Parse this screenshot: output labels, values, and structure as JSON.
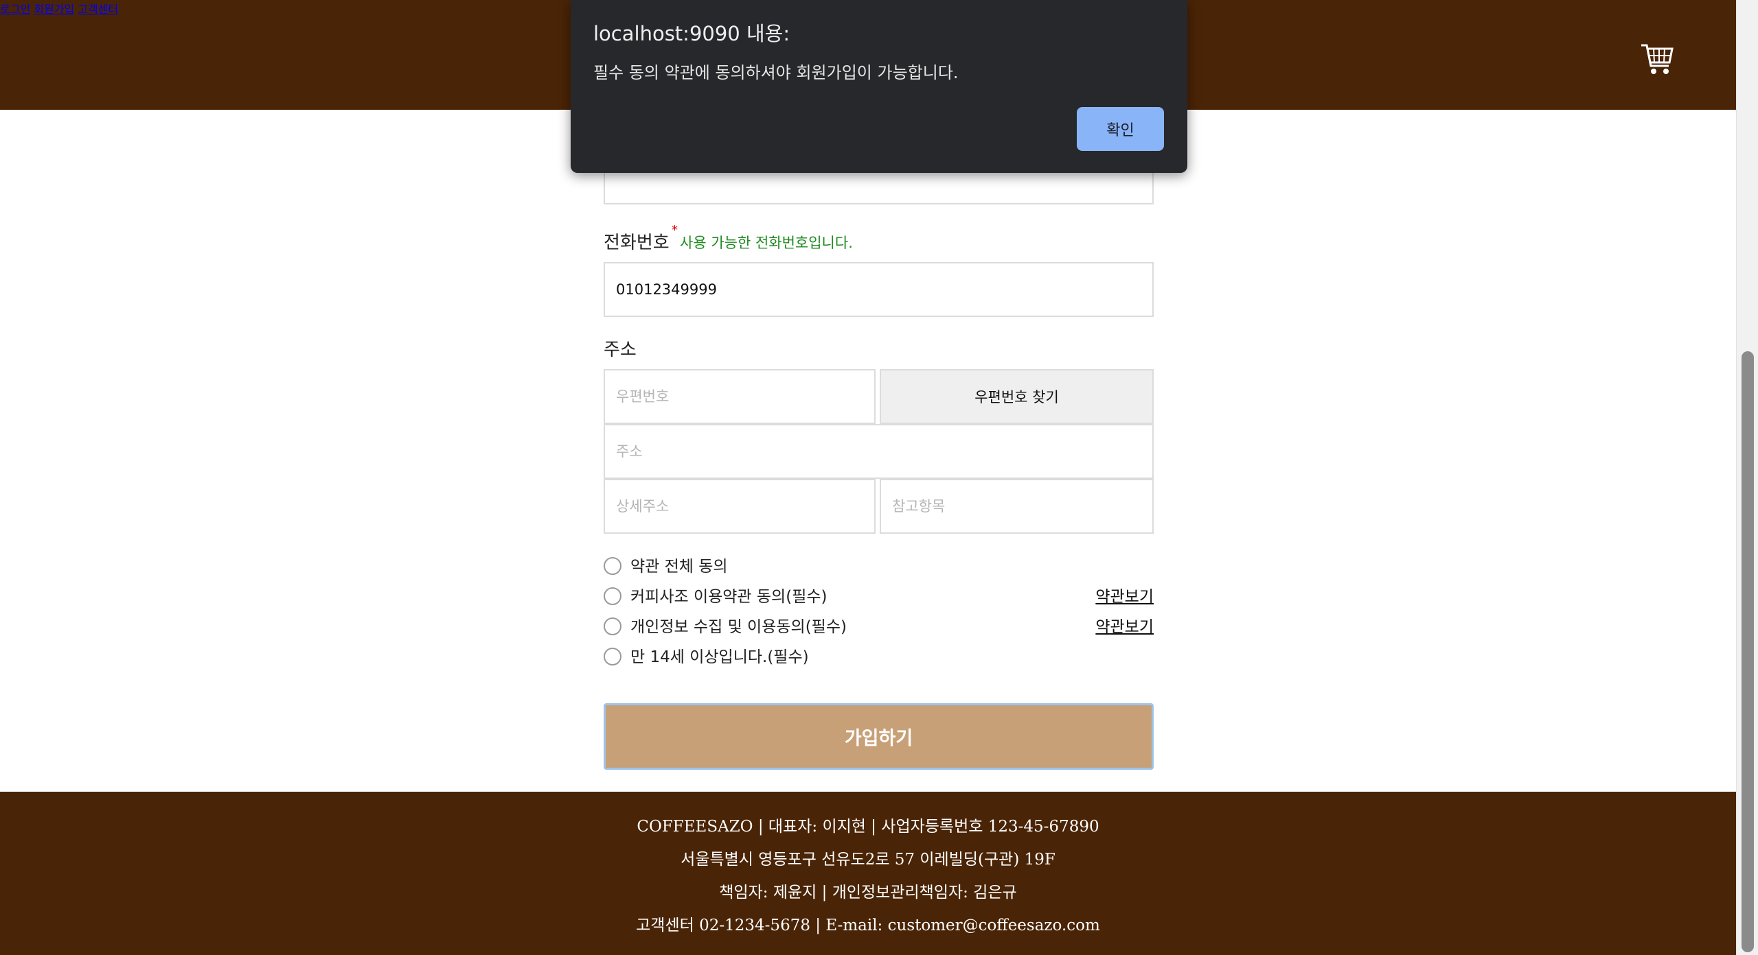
{
  "header": {
    "nav": {
      "login": "로그인",
      "signup": "회원가입",
      "support": "고객센터"
    },
    "cart_icon": "cart-icon"
  },
  "form": {
    "phone": {
      "label": "전화번호",
      "required_mark": "*",
      "status_message": "사용 가능한 전화번호입니다.",
      "value": "01012349999"
    },
    "address": {
      "label": "주소",
      "postcode_placeholder": "우편번호",
      "find_postcode_button": "우편번호 찾기",
      "address_placeholder": "주소",
      "detail_placeholder": "상세주소",
      "extra_placeholder": "참고항목"
    },
    "agreements": [
      {
        "label": "약관 전체 동의",
        "checked": false,
        "link": ""
      },
      {
        "label": "커피사조 이용약관 동의(필수)",
        "checked": false,
        "link": "약관보기"
      },
      {
        "label": "개인정보 수집 및 이용동의(필수)",
        "checked": false,
        "link": "약관보기"
      },
      {
        "label": "만 14세 이상입니다.(필수)",
        "checked": false,
        "link": ""
      }
    ],
    "submit_label": "가입하기"
  },
  "footer": {
    "line1": "COFFEESAZO | 대표자: 이지현 | 사업자등록번호 123-45-67890",
    "line2": "서울특별시 영등포구 선유도2로 57 이레빌딩(구관) 19F",
    "line3": "책임자: 제윤지 | 개인정보관리책임자: 김은규",
    "line4": "고객센터 02-1234-5678 | E-mail: customer@coffeesazo.com"
  },
  "dialog": {
    "title": "localhost:9090 내용:",
    "message": "필수 동의 약관에 동의하셔야 회원가입이 가능합니다.",
    "ok_label": "확인"
  },
  "colors": {
    "header_bg": "#4a2406",
    "submit_bg": "#c8a077",
    "success_text": "#1e8a1e",
    "dialog_bg": "#27282c",
    "dialog_button": "#8ab4f8"
  }
}
